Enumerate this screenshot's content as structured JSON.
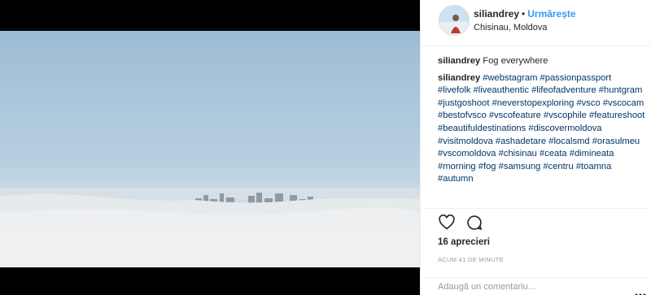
{
  "post": {
    "username": "siliandrey",
    "separator": "•",
    "follow_label": "Urmărește",
    "location": "Chisinau, Moldova",
    "caption": "Fog everywhere",
    "hashtags": [
      "#webstagram",
      "#passionpassport",
      "#livefolk",
      "#liveauthentic",
      "#lifeofadventure",
      "#huntgram",
      "#justgoshoot",
      "#neverstopexploring",
      "#vsco",
      "#vscocam",
      "#bestofvsco",
      "#vscofeature",
      "#vscophile",
      "#featureshoot",
      "#beautifuldestinations",
      "#discovermoldova",
      "#visitmoldova",
      "#ashadetare",
      "#localsmd",
      "#orasulmeu",
      "#vscomoldova",
      "#chisinau",
      "#ceata",
      "#dimineata",
      "#morning",
      "#fog",
      "#samsung",
      "#centru",
      "#toamna",
      "#autumn"
    ],
    "likes": "16 aprecieri",
    "time_ago": "ACUM 41 DE MINUTE",
    "comment_placeholder": "Adaugă un comentariu..."
  },
  "icons": {
    "like": "heart-icon",
    "comment": "comment-bubble-icon",
    "more": "more-options-icon"
  },
  "colors": {
    "follow": "#3897f0",
    "hashtag": "#003569",
    "muted": "#999999"
  }
}
